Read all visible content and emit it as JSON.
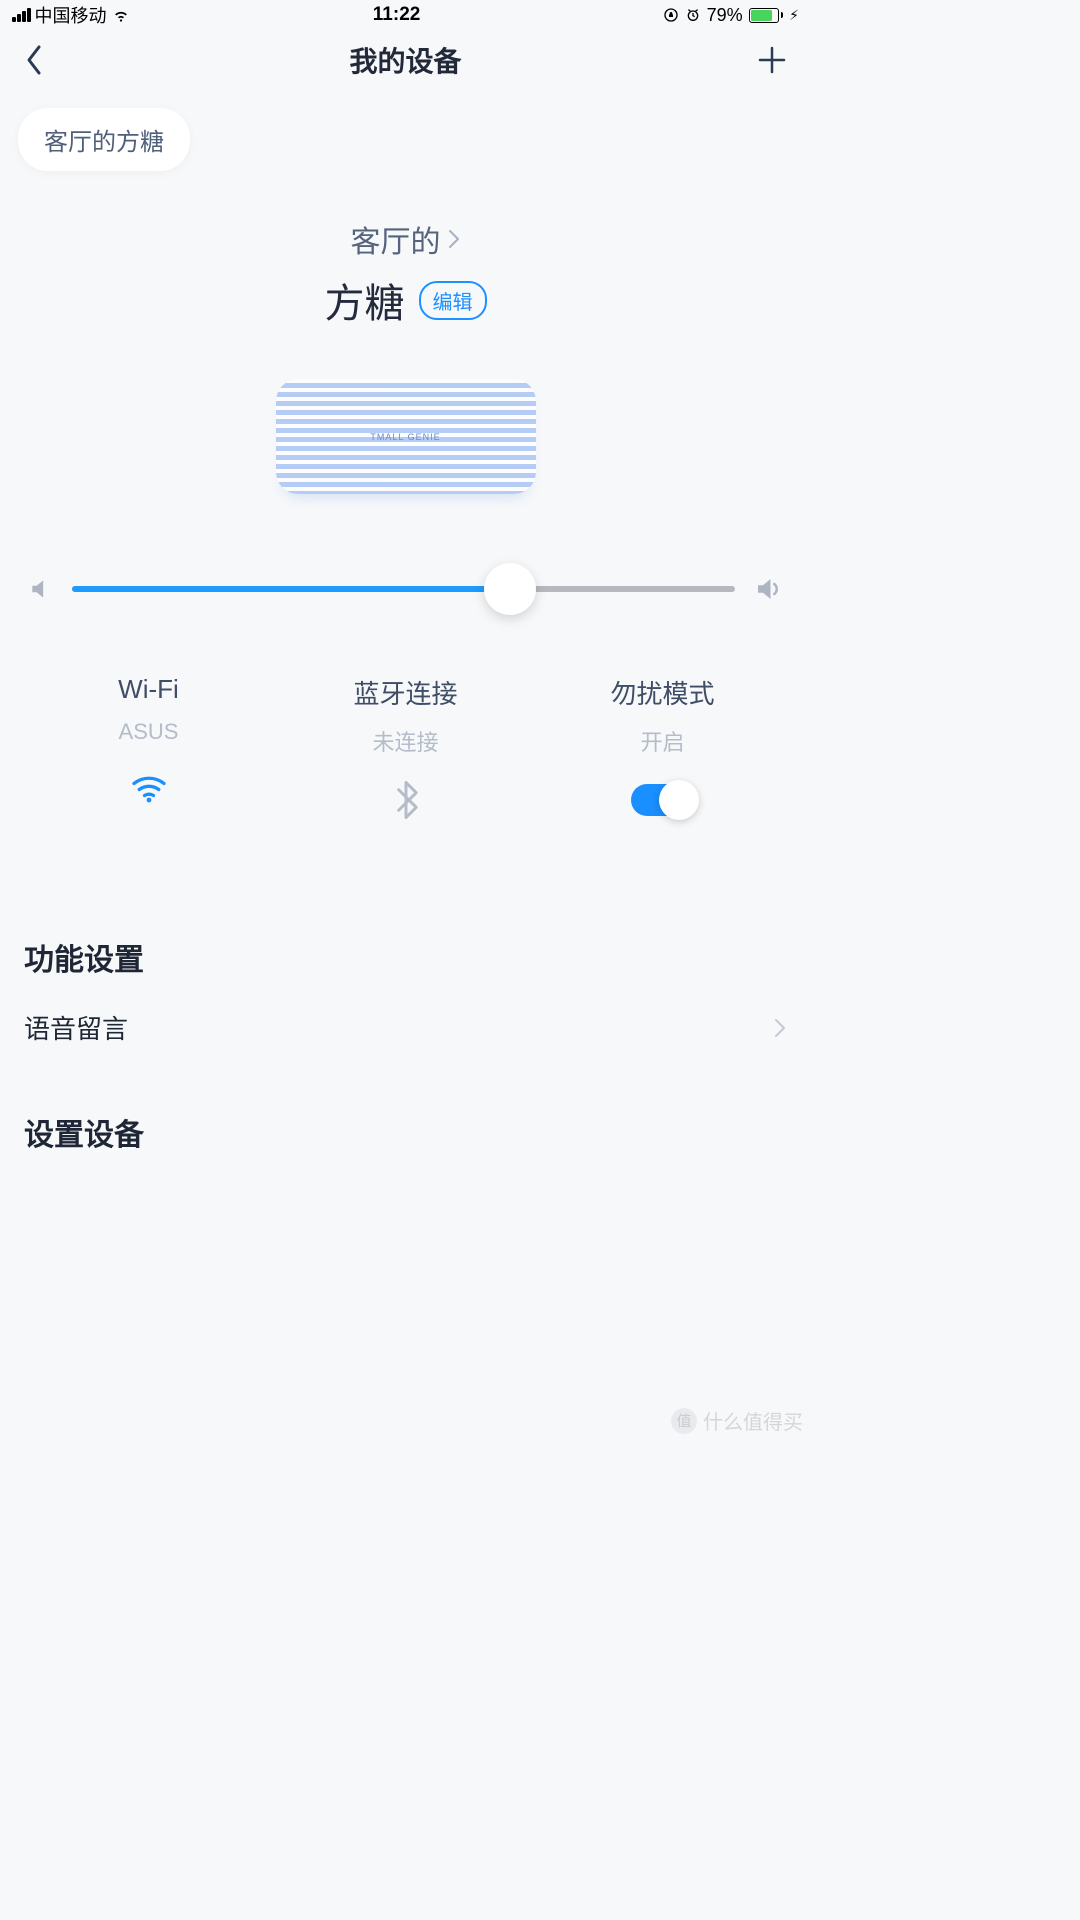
{
  "status": {
    "carrier": "中国移动",
    "time": "11:22",
    "battery_pct": "79%"
  },
  "nav": {
    "title": "我的设备"
  },
  "chip": {
    "label": "客厅的方糖"
  },
  "device": {
    "room": "客厅的",
    "name": "方糖",
    "edit": "编辑",
    "brand": "TMALL GENIE"
  },
  "volume": {
    "percent": 66
  },
  "tiles": {
    "wifi": {
      "title": "Wi-Fi",
      "sub": "ASUS"
    },
    "bluetooth": {
      "title": "蓝牙连接",
      "sub": "未连接"
    },
    "dnd": {
      "title": "勿扰模式",
      "sub": "开启"
    }
  },
  "sections": {
    "features_title": "功能设置",
    "voice_message": "语音留言",
    "device_settings": "设置设备"
  },
  "watermark": "什么值得买"
}
